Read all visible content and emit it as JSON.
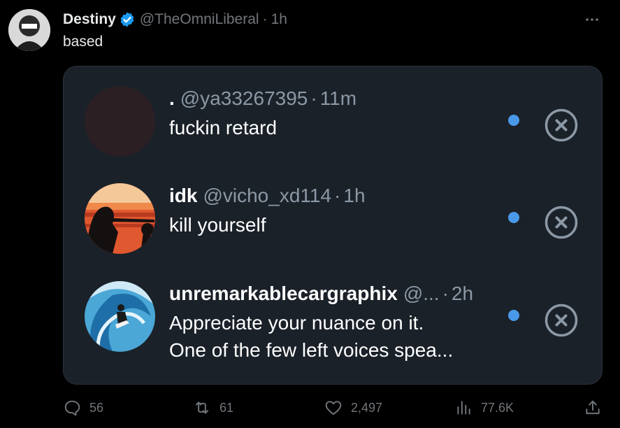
{
  "post": {
    "author_name": "Destiny",
    "handle": "@TheOmniLiberal",
    "separator": "·",
    "time": "1h",
    "text": "based",
    "verified": true,
    "more_icon": "ellipsis-icon"
  },
  "replies": [
    {
      "name": ".",
      "handle": "@ya33267395",
      "separator": "·",
      "time": "11m",
      "lines": [
        "fuckin retard"
      ],
      "unread": true,
      "avatar_color": "#2b1f24"
    },
    {
      "name": "idk",
      "handle": "@vicho_xd114",
      "separator": "·",
      "time": "1h",
      "lines": [
        "kill yourself"
      ],
      "unread": true,
      "avatar_color": "#e0582f"
    },
    {
      "name": "unremarkablecargraphix",
      "handle": "@...",
      "separator": "·",
      "time": "2h",
      "lines": [
        "Appreciate your nuance on it.",
        "One of the few left voices spea..."
      ],
      "unread": true,
      "avatar_color": "#4aa7d6"
    }
  ],
  "actions": {
    "replies": "56",
    "reposts": "61",
    "likes": "2,497",
    "views": "77.6K"
  },
  "colors": {
    "background": "#000000",
    "card": "#1b2129",
    "accent": "#1d9bf0",
    "unread_dot": "#4a99e9",
    "muted": "#71767b"
  }
}
